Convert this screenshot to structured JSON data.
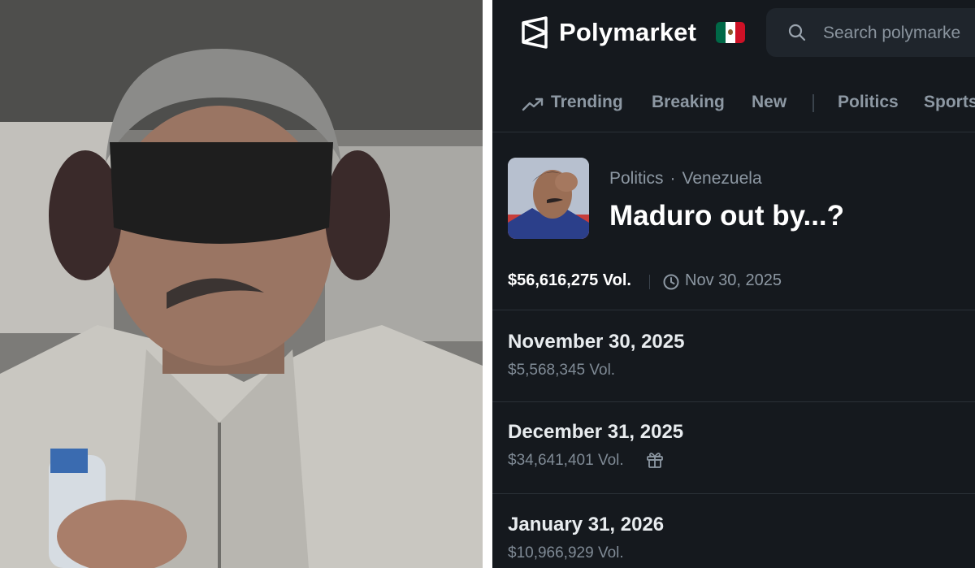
{
  "header": {
    "brand": "Polymarket",
    "search_placeholder": "Search polymarke",
    "flag_colors": [
      "#006847",
      "#ffffff",
      "#ce1126"
    ]
  },
  "nav": {
    "items": [
      {
        "label": "Trending",
        "icon": "trending-up-icon"
      },
      {
        "label": "Breaking"
      },
      {
        "label": "New"
      },
      {
        "label": "Politics"
      },
      {
        "label": "Sports"
      }
    ]
  },
  "market": {
    "category": "Politics",
    "subcategory": "Venezuela",
    "separator": "·",
    "title": "Maduro out by...?",
    "total_volume": "$56,616,275 Vol.",
    "end_date": "Nov 30, 2025",
    "outcomes": [
      {
        "title": "November 30, 2025",
        "volume": "$5,568,345 Vol."
      },
      {
        "title": "December 31, 2025",
        "volume": "$34,641,401 Vol.",
        "icon": "gift-icon"
      },
      {
        "title": "January 31, 2026",
        "volume": "$10,966,929 Vol."
      }
    ]
  },
  "colors": {
    "background": "#15191e",
    "text_primary": "#ffffff",
    "text_secondary": "#8d98a3"
  }
}
